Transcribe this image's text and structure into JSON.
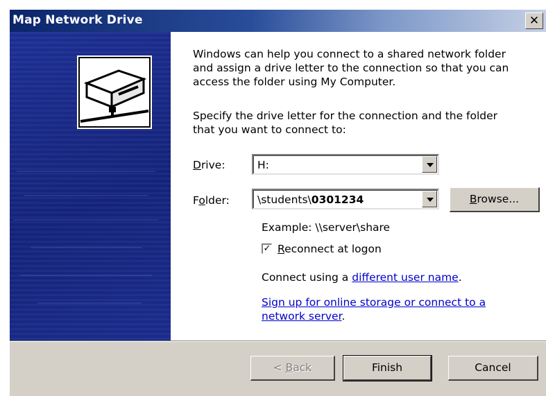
{
  "window": {
    "title": "Map Network Drive",
    "close_label": "✕"
  },
  "intro": {
    "line1": "Windows can help you connect to a shared network folder",
    "line2": "and assign a drive letter to the connection so that you can",
    "line3": "access the folder using My Computer."
  },
  "instruction": {
    "line1": "Specify the drive letter for the connection and the folder",
    "line2": "that you want to connect to:"
  },
  "drive": {
    "label_accel": "D",
    "label_rest": "rive:",
    "value": "H:"
  },
  "folder": {
    "label_pre": "F",
    "label_accel": "o",
    "label_rest": "lder:",
    "value_prefix": "\\students\\",
    "value_bold": "0301234",
    "browse_accel": "B",
    "browse_rest": "rowse..."
  },
  "example": "Example: \\\\server\\share",
  "reconnect": {
    "checked_glyph": "✓",
    "label_accel": "R",
    "label_rest": "econnect at logon"
  },
  "connect_using": {
    "prefix": "Connect using a ",
    "link": "different user name",
    "suffix": "."
  },
  "signup": {
    "line1": "Sign up for online storage or connect to a",
    "line2": "network server",
    "suffix": "."
  },
  "buttons": {
    "back_pre": "< ",
    "back_accel": "B",
    "back_rest": "ack",
    "finish": "Finish",
    "cancel": "Cancel"
  },
  "colors": {
    "side_panel": "#1a2a8c",
    "dialog_face": "#d4d0c8",
    "link": "#0000cc"
  }
}
